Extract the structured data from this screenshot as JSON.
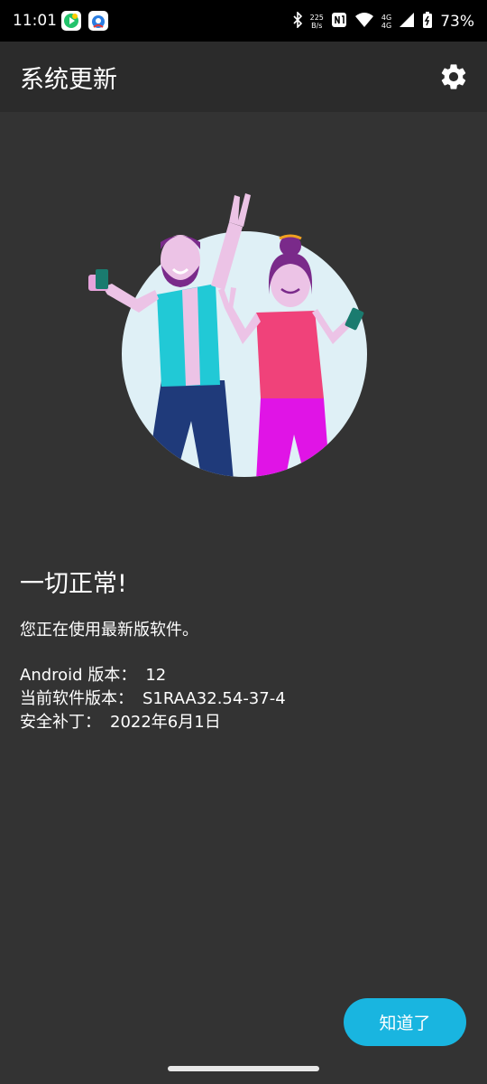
{
  "status_bar": {
    "time": "11:01",
    "net_speed_value": "225",
    "net_speed_unit": "B/s",
    "signal_label_top": "4G",
    "signal_label_bottom": "4G",
    "battery": "73%",
    "icons": [
      "video-app-icon",
      "browser-app-icon",
      "bluetooth-icon",
      "nfc-icon",
      "wifi-icon",
      "signal-icon",
      "battery-icon"
    ]
  },
  "app_bar": {
    "title": "系统更新",
    "settings_icon": "gear-icon"
  },
  "main": {
    "heading": "一切正常!",
    "subtext": "您正在使用最新版软件。",
    "info": [
      {
        "label": "Android 版本：",
        "value": "12"
      },
      {
        "label": "当前软件版本：",
        "value": "S1RAA32.54-37-4"
      },
      {
        "label": "安全补丁：",
        "value": "2022年6月1日"
      }
    ]
  },
  "actions": {
    "ok_label": "知道了",
    "accent_color": "#19b5e0"
  },
  "colors": {
    "background": "#333333",
    "app_bar": "#2b2b2b",
    "status_bar": "#000000"
  }
}
